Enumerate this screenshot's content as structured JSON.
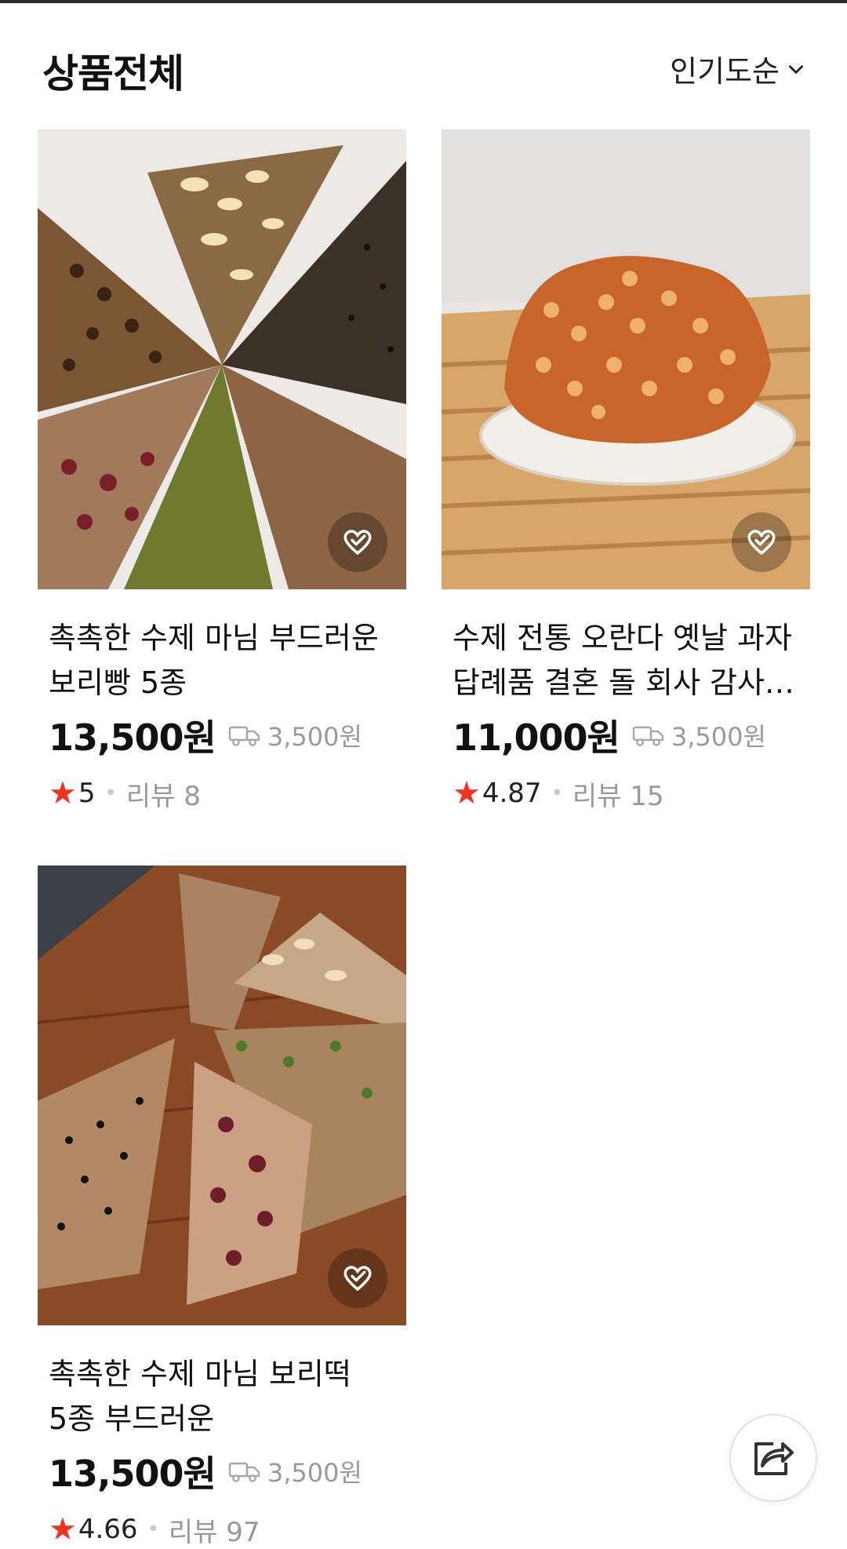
{
  "header": {
    "title": "상품전체",
    "sort_label": "인기도순",
    "sort_icon": "chevron-down-icon"
  },
  "products": [
    {
      "title": "촉촉한 수제 마님 부드러운 보리빵 5종",
      "price": "13,500원",
      "shipping": "3,500원",
      "rating": "5",
      "review": "리뷰 8"
    },
    {
      "title": "수제 전통 오란다 옛날 과자 답례품 결혼 돌 회사 감사…",
      "price": "11,000원",
      "shipping": "3,500원",
      "rating": "4.87",
      "review": "리뷰 15"
    },
    {
      "title": "촉촉한 수제 마님 보리떡 5종 부드러운",
      "price": "13,500원",
      "shipping": "3,500원",
      "rating": "4.66",
      "review": "리뷰 97"
    }
  ],
  "icons": {
    "wishlist": "heart-check-icon",
    "shipping": "truck-icon",
    "rating": "star-icon",
    "share": "share-icon"
  },
  "colors": {
    "star": "#f0321e",
    "muted": "#9a9a9a",
    "text": "#111111"
  }
}
